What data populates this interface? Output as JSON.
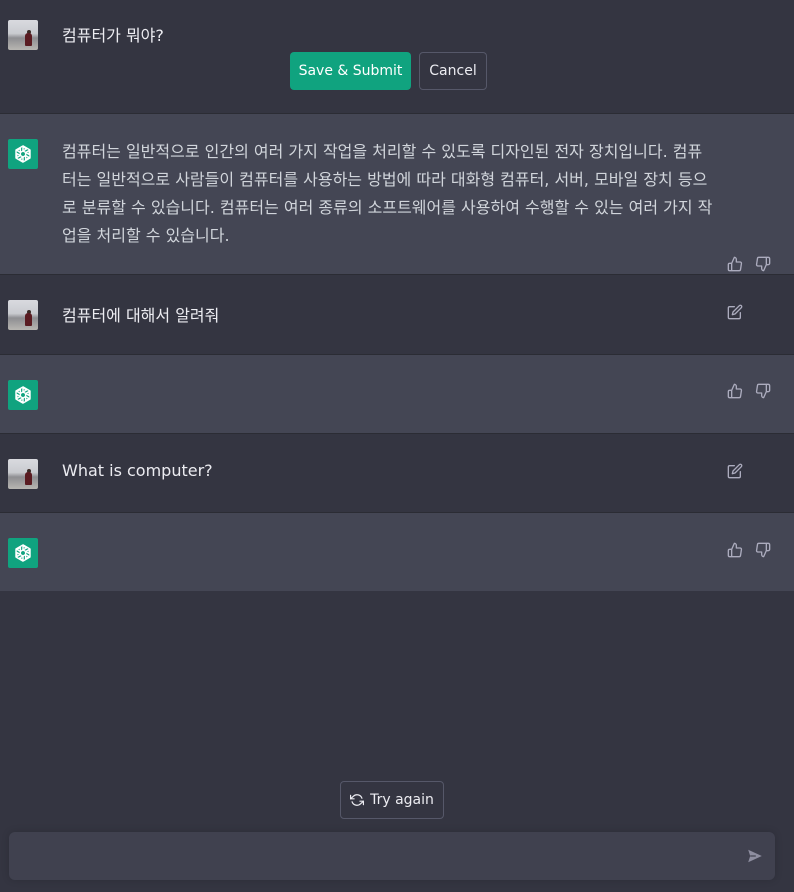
{
  "edit_row": {
    "text": "컴퓨터가 뭐야?",
    "save_label": "Save & Submit",
    "cancel_label": "Cancel"
  },
  "reply_1": {
    "text": "컴퓨터는 일반적으로 인간의 여러 가지 작업을 처리할 수 있도록 디자인된 전자 장치입니다. 컴퓨터는 일반적으로 사람들이 컴퓨터를 사용하는 방법에 따라 대화형 컴퓨터, 서버, 모바일 장치 등으로 분류할 수 있습니다. 컴퓨터는 여러 종류의 소프트웨어를 사용하여 수행할 수 있는 여러 가지 작업을 처리할 수 있습니다."
  },
  "user_2": {
    "text": "컴퓨터에 대해서 알려줘"
  },
  "reply_2": {
    "text": ""
  },
  "user_3": {
    "text": "What is computer?"
  },
  "reply_3": {
    "text": ""
  },
  "try_again": {
    "label": "Try again"
  },
  "composer": {
    "value": "",
    "placeholder": ""
  },
  "icons": {
    "user_avatar": "user-photo",
    "bot_avatar": "openai-logo",
    "like": "thumbs-up-icon",
    "dislike": "thumbs-down-icon",
    "edit": "edit-icon",
    "regenerate": "refresh-icon",
    "send": "send-icon"
  },
  "colors": {
    "accent": "#10a37f",
    "bg_user": "#343541",
    "bg_bot": "#444654"
  }
}
